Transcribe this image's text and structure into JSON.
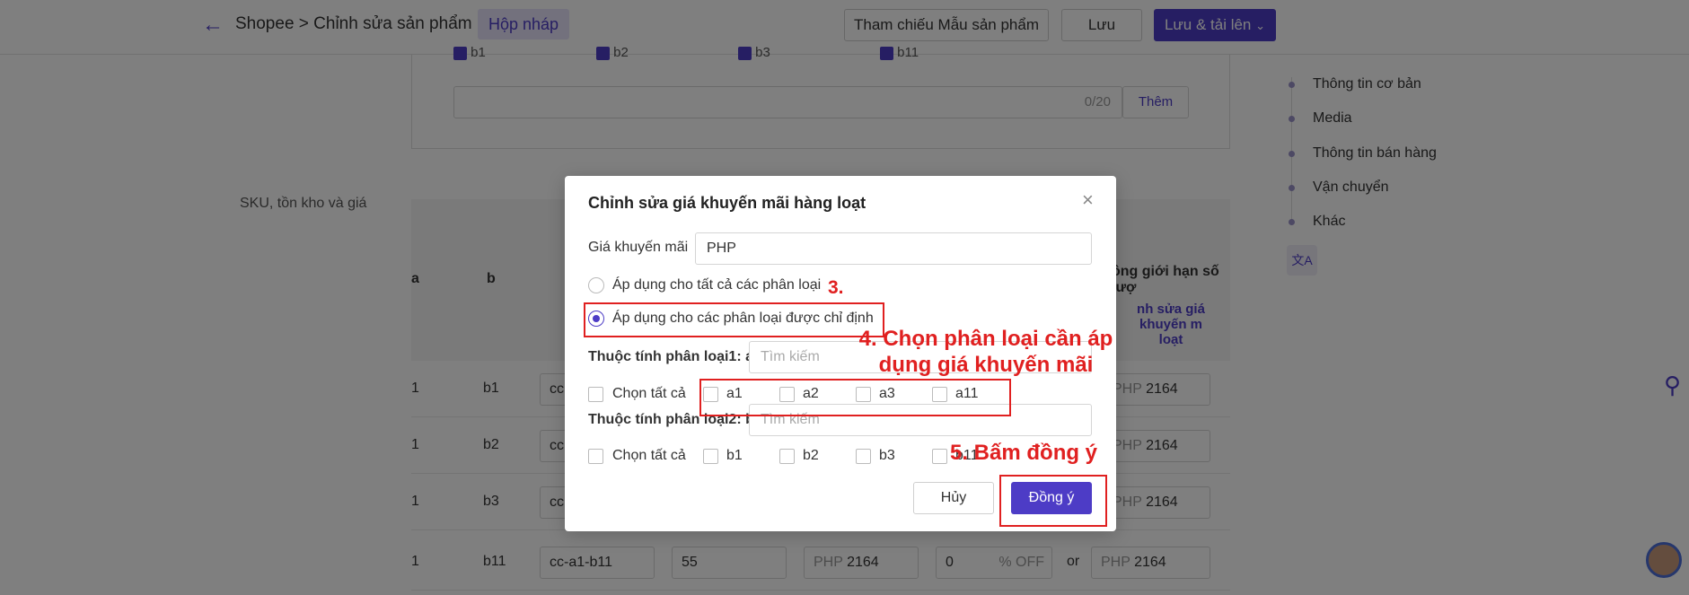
{
  "header": {
    "breadcrumb": "Shopee > Chỉnh sửa sản phẩm",
    "draft_badge": "Hộp nháp",
    "ref_button": "Tham chiếu Mẫu sản phẩm",
    "save_button": "Lưu",
    "publish_button": "Lưu & tải lên"
  },
  "variant_box": {
    "options": [
      "b1",
      "b2",
      "b3",
      "b11"
    ],
    "counter": "0/20",
    "add_button": "Thêm"
  },
  "sku_section": {
    "label": "SKU, tồn kho và giá",
    "col_a": "a",
    "col_b": "b",
    "col_limit": "ông giới hạn số lượ",
    "col_edit_line1": "nh sửa giá khuyến m",
    "col_edit_line2": "loạt",
    "rows": [
      {
        "a": "1",
        "b": "b1",
        "sku": "cc",
        "price": "2164"
      },
      {
        "a": "1",
        "b": "b2",
        "sku": "cc",
        "price": "2164"
      },
      {
        "a": "1",
        "b": "b3",
        "sku": "cc",
        "price": "2164"
      },
      {
        "a": "1",
        "b": "b11",
        "sku": "cc-a1-b11",
        "stock": "55",
        "price": "2164",
        "discount": "0",
        "discount_unit": "% OFF",
        "or": "or",
        "price2": "2164"
      }
    ],
    "currency": "PHP"
  },
  "sidenav": {
    "items": [
      "Thông tin cơ bản",
      "Media",
      "Thông tin bán hàng",
      "Vận chuyển",
      "Khác"
    ],
    "translate_icon": "文A"
  },
  "modal": {
    "title": "Chỉnh sửa giá khuyến mãi hàng loạt",
    "price_label": "Giá khuyến mãi",
    "price_placeholder": "PHP",
    "radio_all": "Áp dụng cho tất cả các phân loại",
    "radio_specific": "Áp dụng cho các phân loại được chỉ định",
    "attr1_label": "Thuộc tính phân loại1: a",
    "attr2_label": "Thuộc tính phân loại2: b",
    "search_placeholder": "Tìm kiếm",
    "select_all": "Chọn tất cả",
    "attr1_options": [
      "a1",
      "a2",
      "a3",
      "a11"
    ],
    "attr2_options": [
      "b1",
      "b2",
      "b3",
      "b11"
    ],
    "cancel_button": "Hủy",
    "ok_button": "Đồng ý"
  },
  "annotations": {
    "step3": "3.",
    "step4": "4. Chọn phân loại cần áp dụng giá khuyến mãi",
    "step5": "5. Bấm đồng ý"
  }
}
